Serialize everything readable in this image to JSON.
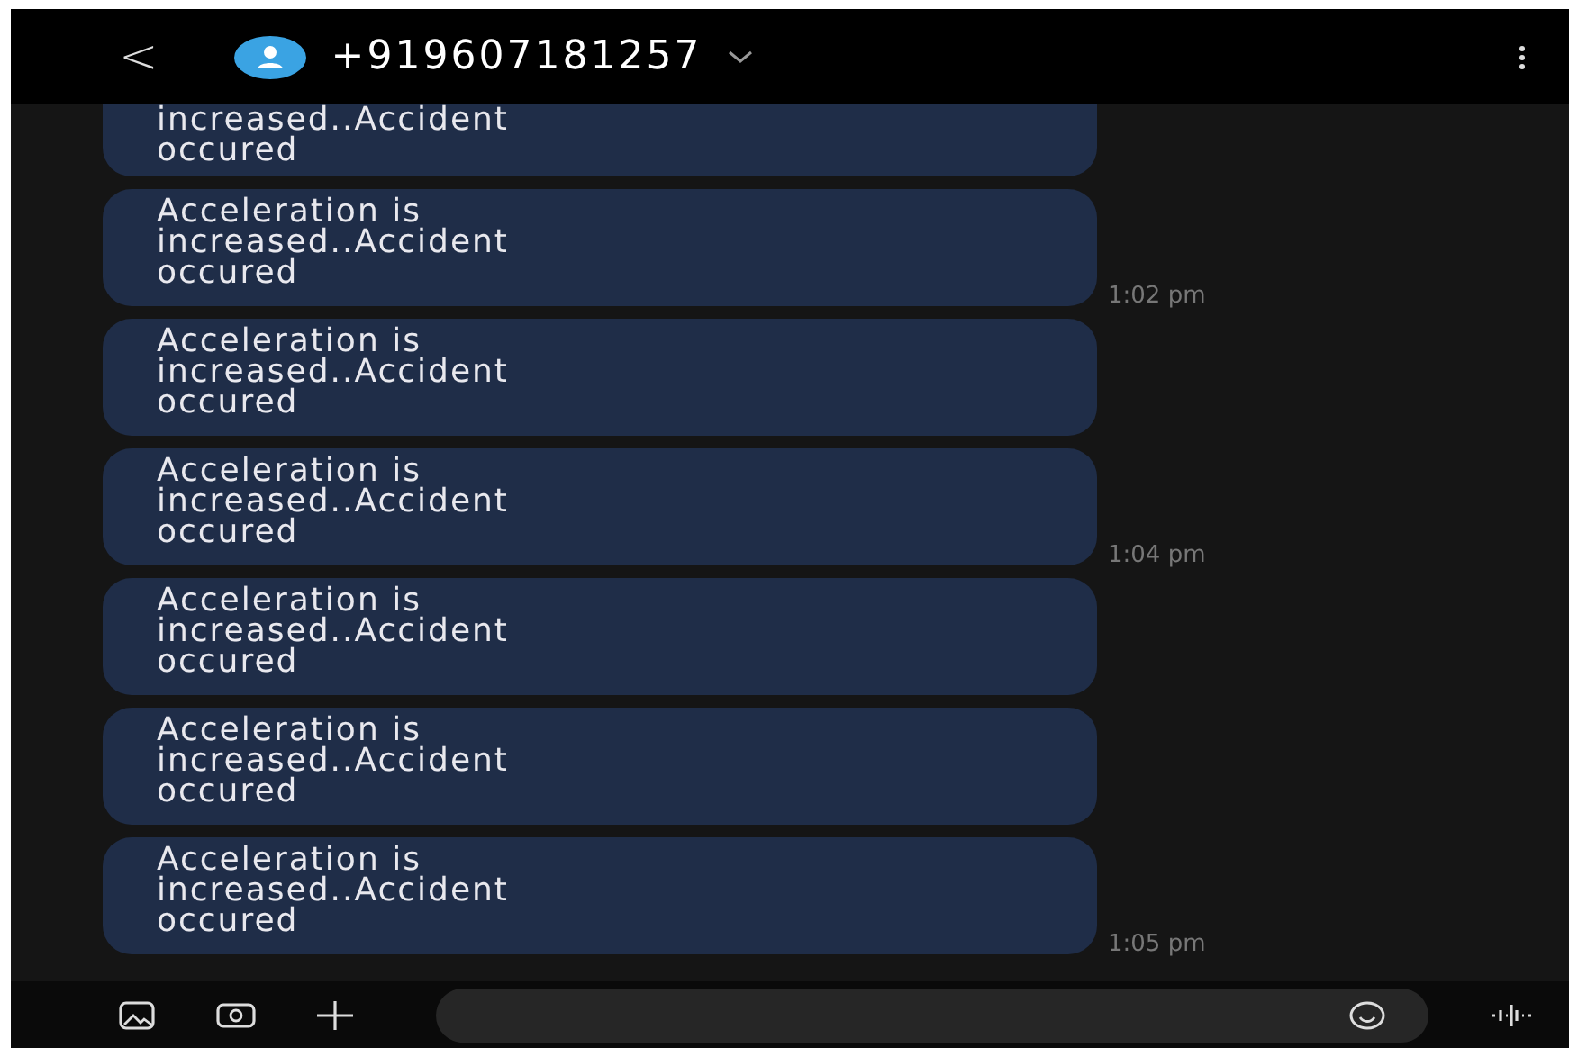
{
  "header": {
    "back": "<",
    "contact": "+919607181257"
  },
  "messages": [
    {
      "text": "increased..Accident occured"
    },
    {
      "text": "Acceleration is increased..Accident occured",
      "time": "1:02 pm"
    },
    {
      "text": "Acceleration is increased..Accident occured"
    },
    {
      "text": "Acceleration is increased..Accident occured",
      "time": "1:04 pm"
    },
    {
      "text": "Acceleration is increased..Accident occured"
    },
    {
      "text": "Acceleration is increased..Accident occured"
    },
    {
      "text": "Acceleration is increased..Accident occured",
      "time": "1:05 pm"
    }
  ]
}
